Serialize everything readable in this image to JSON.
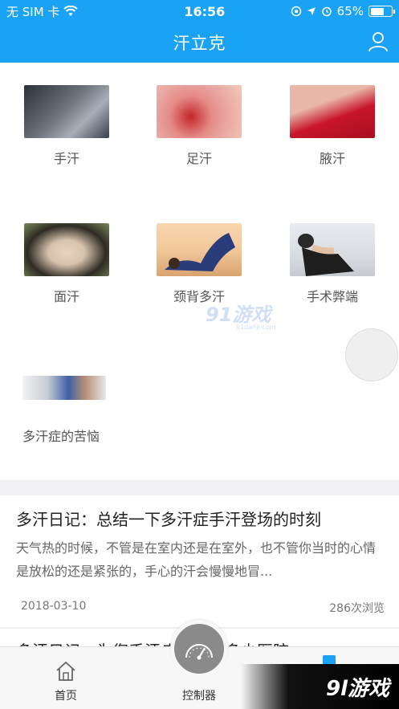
{
  "status_bar": {
    "carrier": "无 SIM 卡",
    "time": "16:56",
    "battery_percent": "65%",
    "battery_level": 0.65,
    "icons": [
      "wifi-icon",
      "orientation-lock-icon",
      "location-icon",
      "alarm-icon",
      "battery-icon"
    ]
  },
  "nav": {
    "title": "汗立克",
    "user_icon": "user-icon"
  },
  "categories": [
    {
      "label": "手汗",
      "thumb_colors": [
        "#3a3f48",
        "#a9aeb6"
      ]
    },
    {
      "label": "足汗",
      "thumb_colors": [
        "#e9a6a2",
        "#c4262c"
      ]
    },
    {
      "label": "腋汗",
      "thumb_colors": [
        "#e8b7a7",
        "#c8152a"
      ]
    },
    {
      "label": "面汗",
      "thumb_colors": [
        "#2f2b24",
        "#d6c2ad"
      ]
    },
    {
      "label": "颈背多汗",
      "thumb_colors": [
        "#f2c89b",
        "#2a3d7a"
      ]
    },
    {
      "label": "手术弊端",
      "thumb_colors": [
        "#d9dde2",
        "#2a2a2a"
      ]
    },
    {
      "label": "多汗症的苦恼",
      "thumb_colors": [
        "#c8ccd4",
        "#3f5fa6"
      ]
    }
  ],
  "articles": [
    {
      "title": "多汗日记：总结一下多汗症手汗登场的时刻",
      "summary": "天气热的时候，不管是在室内还是在室外，也不管你当时的心情是放松的还是紧张的，手心的汗会慢慢地冒...",
      "date": "2018-03-10",
      "views": "286次浏览"
    },
    {
      "title": "多汗日记：为您手汗症状已请多少医院"
    }
  ],
  "tabs": {
    "home_label": "首页",
    "controller_label": "控制器"
  },
  "watermarks": {
    "center": "91游戏",
    "center_sub": "91danji.com",
    "corner": "9l游戏"
  },
  "colors": {
    "accent": "#1aa3f5"
  }
}
